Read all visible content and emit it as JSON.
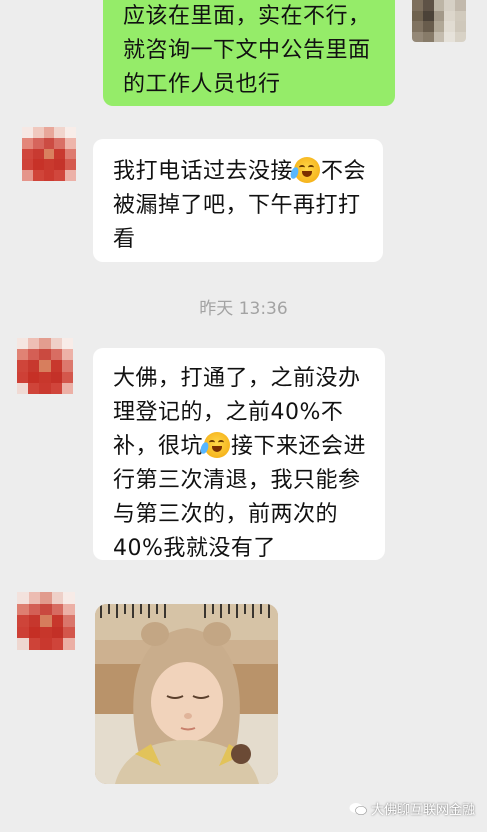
{
  "messages": {
    "outgoing_1": "应该在里面，实在不行，就咨询一下文中公告里面的工作人员也行",
    "incoming_1_part1": "我打电话过去没接",
    "incoming_1_part2": "不会被漏掉了吧，下午再打打看",
    "incoming_2_part1": "大佛，打通了，之前没办理登记的，之前40%不补，很坑",
    "incoming_2_part2": "接下来还会进行第三次清退，我只能参与第三次的，前两次的40%我就没有了"
  },
  "timestamp": "昨天 13:36",
  "watermark": "大佛聊互联网金融",
  "icons": {
    "emoji": "crying-laughing-emoji",
    "watermark": "wechat-icon"
  },
  "colors": {
    "chat_background": "#ededed",
    "outgoing_bubble": "#95ec69",
    "incoming_bubble": "#ffffff",
    "timestamp_text": "#a3a3a3"
  }
}
